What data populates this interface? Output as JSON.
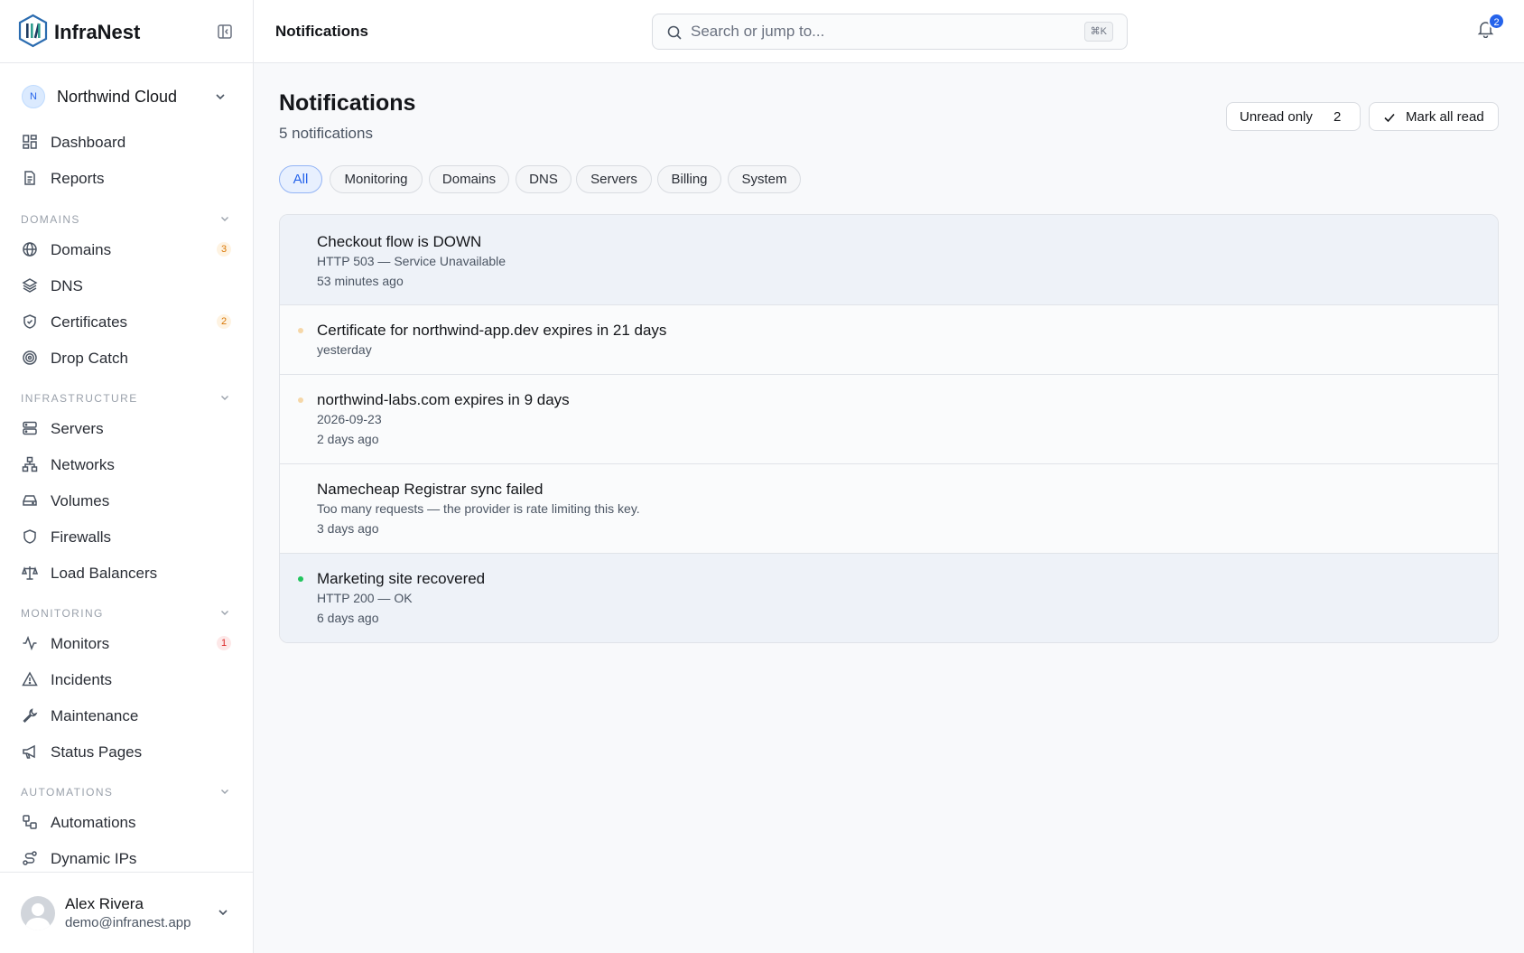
{
  "app": {
    "name": "InfraNest"
  },
  "org": {
    "initial": "N",
    "name": "Northwind Cloud"
  },
  "nav": {
    "top": [
      {
        "label": "Dashboard",
        "icon": "dashboard-icon"
      },
      {
        "label": "Reports",
        "icon": "document-icon"
      }
    ],
    "sections": [
      {
        "title": "DOMAINS",
        "items": [
          {
            "label": "Domains",
            "icon": "globe-icon",
            "badge": "3",
            "badge_tone": "warn"
          },
          {
            "label": "DNS",
            "icon": "layers-icon"
          },
          {
            "label": "Certificates",
            "icon": "shield-check-icon",
            "badge": "2",
            "badge_tone": "warn"
          },
          {
            "label": "Drop Catch",
            "icon": "target-icon"
          }
        ]
      },
      {
        "title": "INFRASTRUCTURE",
        "items": [
          {
            "label": "Servers",
            "icon": "server-icon"
          },
          {
            "label": "Networks",
            "icon": "network-icon"
          },
          {
            "label": "Volumes",
            "icon": "drive-icon"
          },
          {
            "label": "Firewalls",
            "icon": "shield-icon"
          },
          {
            "label": "Load Balancers",
            "icon": "scale-icon"
          }
        ]
      },
      {
        "title": "MONITORING",
        "items": [
          {
            "label": "Monitors",
            "icon": "activity-icon",
            "badge": "1",
            "badge_tone": "err"
          },
          {
            "label": "Incidents",
            "icon": "warning-icon"
          },
          {
            "label": "Maintenance",
            "icon": "wrench-icon"
          },
          {
            "label": "Status Pages",
            "icon": "megaphone-icon"
          }
        ]
      },
      {
        "title": "AUTOMATIONS",
        "items": [
          {
            "label": "Automations",
            "icon": "workflow-icon"
          },
          {
            "label": "Dynamic IPs",
            "icon": "route-icon"
          }
        ]
      }
    ]
  },
  "user": {
    "name": "Alex Rivera",
    "email": "demo@infranest.app"
  },
  "header": {
    "title": "Notifications",
    "search_placeholder": "Search or jump to...",
    "search_shortcut": "⌘K",
    "bell_count": "2"
  },
  "page": {
    "title": "Notifications",
    "subtitle": "5 notifications",
    "unread_label": "Unread only",
    "unread_count": "2",
    "mark_all_label": "Mark all read"
  },
  "filters": [
    "All",
    "Monitoring",
    "Domains",
    "DNS",
    "Servers",
    "Billing",
    "System"
  ],
  "colors": {
    "accent": "#2563eb",
    "warn_dot": "#f5d7a8",
    "ok_dot": "#22c55e"
  },
  "notifications": [
    {
      "title": "Checkout flow is DOWN",
      "detail": "HTTP 503 — Service Unavailable",
      "time": "53 minutes ago",
      "unread": true,
      "dot": "none"
    },
    {
      "title": "Certificate for northwind-app.dev expires in 21 days",
      "detail": "",
      "time": "yesterday",
      "unread": false,
      "dot": "warn"
    },
    {
      "title": "northwind-labs.com expires in 9 days",
      "detail": "2026-09-23",
      "time": "2 days ago",
      "unread": false,
      "dot": "warn"
    },
    {
      "title": "Namecheap Registrar sync failed",
      "detail": "Too many requests — the provider is rate limiting this key.",
      "time": "3 days ago",
      "unread": false,
      "dot": "none"
    },
    {
      "title": "Marketing site recovered",
      "detail": "HTTP 200 — OK",
      "time": "6 days ago",
      "unread": true,
      "dot": "ok"
    }
  ]
}
